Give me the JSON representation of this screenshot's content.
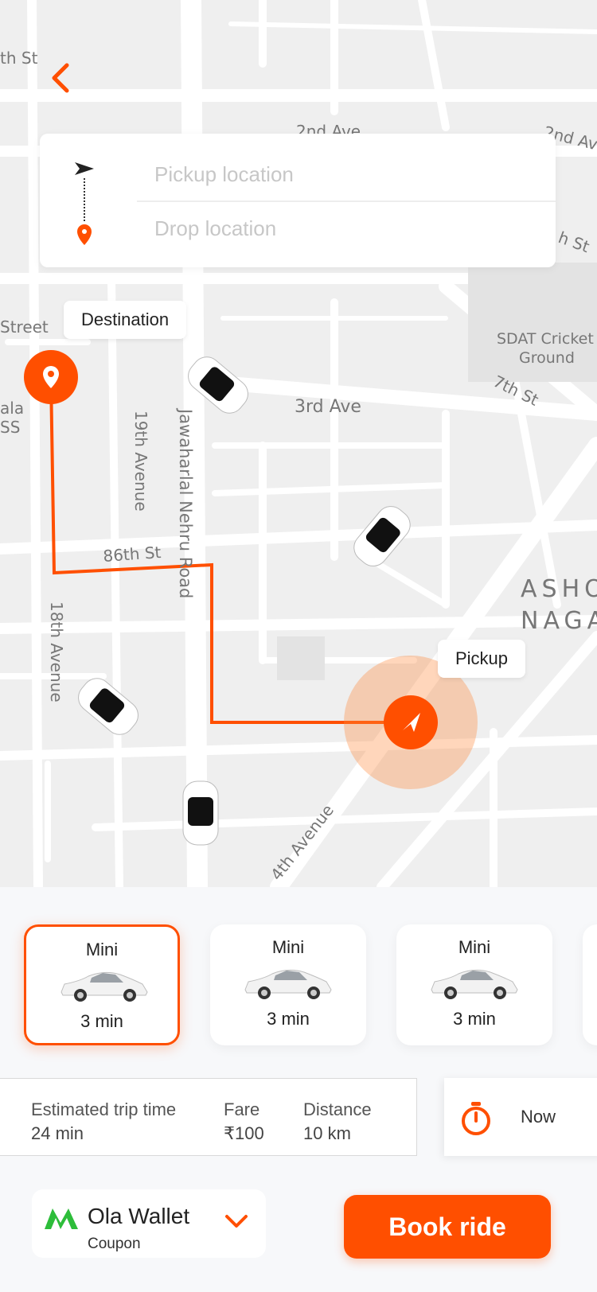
{
  "header": {
    "back_icon": "chevron-left-icon"
  },
  "location": {
    "pickup_placeholder": "Pickup location",
    "drop_placeholder": "Drop location",
    "pickup_value": "",
    "drop_value": ""
  },
  "map": {
    "streets": {
      "s1": "th St",
      "s2": "2nd Ave",
      "s3": "2nd Av",
      "s4": "h St",
      "s5": "Street",
      "s6": "SDAT Cricket",
      "s7": "Ground",
      "s8": "7th St",
      "s9": "3rd Ave",
      "s10": "ala",
      "s11": "SS",
      "s12": "19th Avenue",
      "s13": "Jawaharlal Nehru Road",
      "s14": "86th St",
      "s15": "18th Avenue",
      "s16": "ASHO",
      "s17": "NAGA",
      "s18": "4th Avenue"
    },
    "destination_tag": "Destination",
    "pickup_tag": "Pickup"
  },
  "rides": [
    {
      "name": "Mini",
      "eta": "3 min",
      "selected": true
    },
    {
      "name": "Mini",
      "eta": "3 min",
      "selected": false
    },
    {
      "name": "Mini",
      "eta": "3 min",
      "selected": false
    }
  ],
  "trip": {
    "time_label": "Estimated trip time",
    "time_value": "24 min",
    "fare_label": "Fare",
    "fare_value": "₹100",
    "distance_label": "Distance",
    "distance_value": "10 km"
  },
  "schedule": {
    "label": "Now",
    "icon": "stopwatch-icon"
  },
  "payment": {
    "title": "Ola Wallet",
    "subtitle": "Coupon",
    "icon": "ola-logo-icon"
  },
  "book_label": "Book ride",
  "colors": {
    "accent": "#ff4f00",
    "map_bg": "#efefef",
    "road": "#ffffff"
  }
}
